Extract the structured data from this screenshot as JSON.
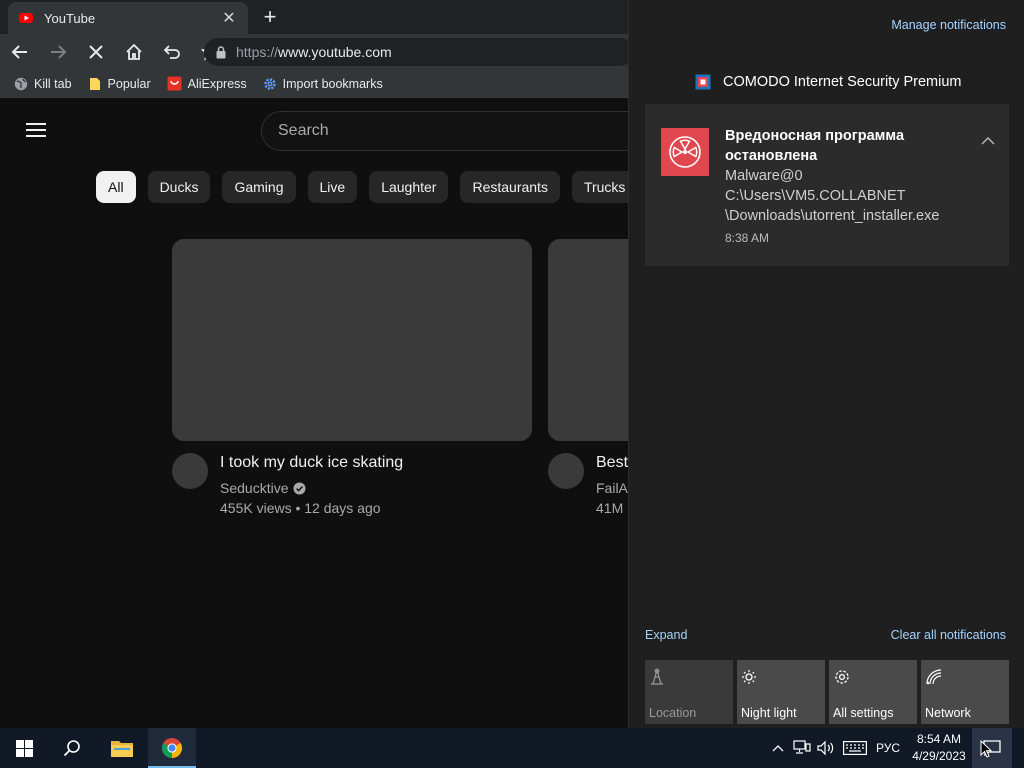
{
  "browser": {
    "tab": {
      "title": "YouTube"
    },
    "url": {
      "scheme": "https://",
      "host": "www.youtube.com"
    },
    "bookmarks": [
      {
        "label": "Kill tab",
        "icon": "globe-icon"
      },
      {
        "label": "Popular",
        "icon": "folder-icon"
      },
      {
        "label": "AliExpress",
        "icon": "aliexpress-icon"
      },
      {
        "label": "Import bookmarks",
        "icon": "gear-icon"
      }
    ]
  },
  "youtube": {
    "search_placeholder": "Search",
    "chips": [
      "All",
      "Ducks",
      "Gaming",
      "Live",
      "Laughter",
      "Restaurants",
      "Trucks"
    ],
    "videos": [
      {
        "title": "I took my duck ice skating",
        "channel": "Seducktive",
        "meta": "455K views • 12 days ago",
        "verified": true
      },
      {
        "title": "Best",
        "channel": "FailA",
        "meta": "41M"
      }
    ]
  },
  "action_center": {
    "manage": "Manage notifications",
    "app_name": "COMODO Internet Security Premium",
    "notification": {
      "title": "Вредоносная программа остановлена",
      "lines": [
        "Malware@0",
        "C:\\Users\\VM5.COLLABNET",
        "\\Downloads\\utorrent_installer.exe"
      ],
      "time": "8:38 AM"
    },
    "expand": "Expand",
    "clear_all": "Clear all notifications",
    "tiles": [
      {
        "label": "Location",
        "icon": "location-icon",
        "enabled": false
      },
      {
        "label": "Night light",
        "icon": "night-light-icon",
        "enabled": true
      },
      {
        "label": "All settings",
        "icon": "settings-icon",
        "enabled": true
      },
      {
        "label": "Network",
        "icon": "network-icon",
        "enabled": true
      }
    ]
  },
  "taskbar": {
    "language": "РУС",
    "time": "8:54 AM",
    "date": "4/29/2023"
  },
  "colors": {
    "accent_link": "#a6d3ff",
    "comodo_red": "#e0474f",
    "taskbar_bg": "#111826"
  }
}
